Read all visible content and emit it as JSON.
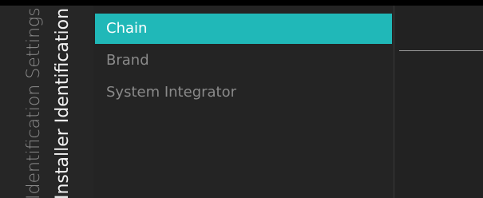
{
  "breadcrumb": {
    "parent": "Identification Settings",
    "current": "Installer Identification"
  },
  "menu": {
    "items": [
      {
        "label": "Chain",
        "selected": true
      },
      {
        "label": "Brand",
        "selected": false
      },
      {
        "label": "System Integrator",
        "selected": false
      }
    ]
  },
  "colors": {
    "accent": "#20b8b8",
    "background": "#252525",
    "text_primary": "#ffffff",
    "text_secondary": "#8a8a8a"
  }
}
